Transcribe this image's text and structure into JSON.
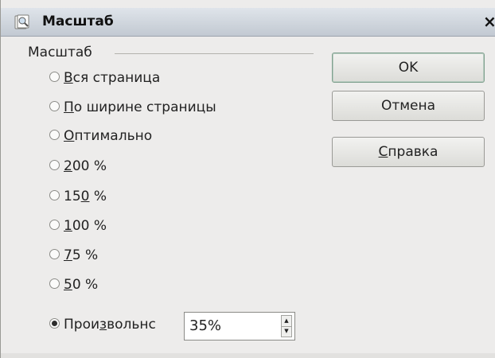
{
  "dialog": {
    "title": "Масштаб",
    "close_glyph": "×",
    "icons": {
      "title": "zoom-dialog-icon",
      "close": "close-icon"
    }
  },
  "zoom_group": {
    "label": "Масштаб",
    "options": [
      {
        "mnemonic": "В",
        "rest": "ся страница"
      },
      {
        "mnemonic": "П",
        "rest": "о ширине страницы"
      },
      {
        "mnemonic": "О",
        "rest": "птимально"
      },
      {
        "mnemonic": "2",
        "rest": "00 %"
      },
      {
        "pre": "15",
        "mnemonic": "0",
        "rest": " %"
      },
      {
        "mnemonic": "1",
        "rest": "00 %"
      },
      {
        "mnemonic": "7",
        "rest": "5 %"
      },
      {
        "mnemonic": "5",
        "rest": "0 %"
      },
      {
        "pre": "Прои",
        "mnemonic": "з",
        "rest": "вольнс"
      }
    ],
    "selected_index": 8,
    "custom_value": "35%"
  },
  "buttons": {
    "ok": "OK",
    "cancel": "Отмена",
    "help_mnemonic": "С",
    "help_rest": "правка"
  },
  "colors": {
    "dialog_bg": "#edeceb",
    "titlebar_top": "#dfe4ea",
    "titlebar_bottom": "#c2c9d2",
    "default_button_border": "#7fa08e"
  }
}
